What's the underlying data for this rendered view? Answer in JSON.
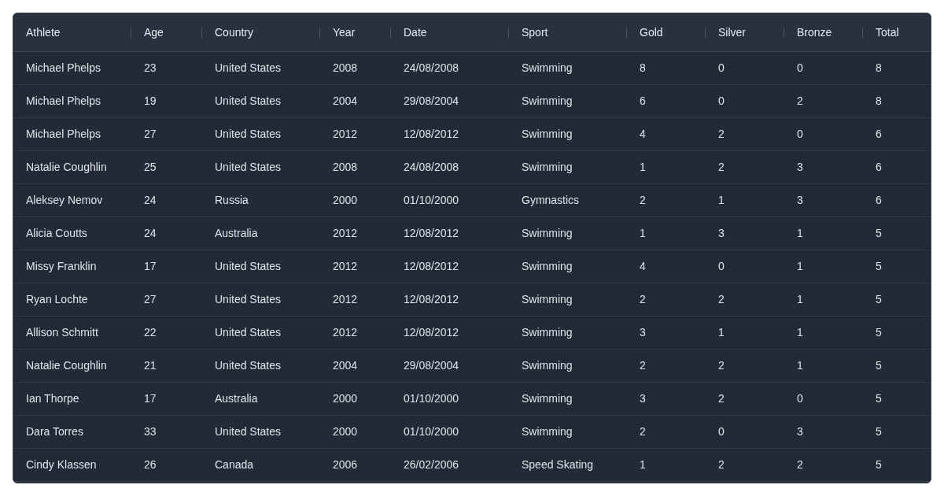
{
  "table": {
    "columns": [
      "Athlete",
      "Age",
      "Country",
      "Year",
      "Date",
      "Sport",
      "Gold",
      "Silver",
      "Bronze",
      "Total"
    ],
    "rows": [
      [
        "Michael Phelps",
        "23",
        "United States",
        "2008",
        "24/08/2008",
        "Swimming",
        "8",
        "0",
        "0",
        "8"
      ],
      [
        "Michael Phelps",
        "19",
        "United States",
        "2004",
        "29/08/2004",
        "Swimming",
        "6",
        "0",
        "2",
        "8"
      ],
      [
        "Michael Phelps",
        "27",
        "United States",
        "2012",
        "12/08/2012",
        "Swimming",
        "4",
        "2",
        "0",
        "6"
      ],
      [
        "Natalie Coughlin",
        "25",
        "United States",
        "2008",
        "24/08/2008",
        "Swimming",
        "1",
        "2",
        "3",
        "6"
      ],
      [
        "Aleksey Nemov",
        "24",
        "Russia",
        "2000",
        "01/10/2000",
        "Gymnastics",
        "2",
        "1",
        "3",
        "6"
      ],
      [
        "Alicia Coutts",
        "24",
        "Australia",
        "2012",
        "12/08/2012",
        "Swimming",
        "1",
        "3",
        "1",
        "5"
      ],
      [
        "Missy Franklin",
        "17",
        "United States",
        "2012",
        "12/08/2012",
        "Swimming",
        "4",
        "0",
        "1",
        "5"
      ],
      [
        "Ryan Lochte",
        "27",
        "United States",
        "2012",
        "12/08/2012",
        "Swimming",
        "2",
        "2",
        "1",
        "5"
      ],
      [
        "Allison Schmitt",
        "22",
        "United States",
        "2012",
        "12/08/2012",
        "Swimming",
        "3",
        "1",
        "1",
        "5"
      ],
      [
        "Natalie Coughlin",
        "21",
        "United States",
        "2004",
        "29/08/2004",
        "Swimming",
        "2",
        "2",
        "1",
        "5"
      ],
      [
        "Ian Thorpe",
        "17",
        "Australia",
        "2000",
        "01/10/2000",
        "Swimming",
        "3",
        "2",
        "0",
        "5"
      ],
      [
        "Dara Torres",
        "33",
        "United States",
        "2000",
        "01/10/2000",
        "Swimming",
        "2",
        "0",
        "3",
        "5"
      ],
      [
        "Cindy Klassen",
        "26",
        "Canada",
        "2006",
        "26/02/2006",
        "Speed Skating",
        "1",
        "2",
        "2",
        "5"
      ]
    ]
  }
}
